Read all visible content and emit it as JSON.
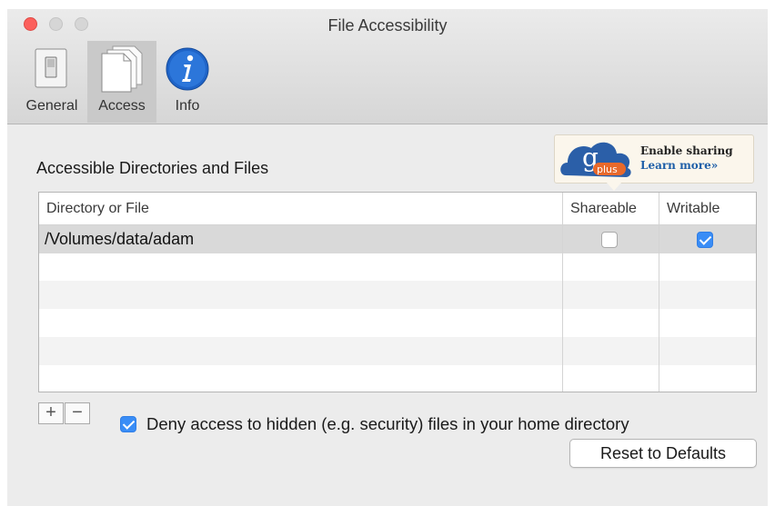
{
  "window": {
    "title": "File Accessibility"
  },
  "tabs": [
    {
      "label": "General",
      "icon": "switch-icon"
    },
    {
      "label": "Access",
      "icon": "documents-icon",
      "selected": true
    },
    {
      "label": "Info",
      "icon": "info-icon"
    }
  ],
  "section_title": "Accessible Directories and Files",
  "promo": {
    "line1": "Enable sharing",
    "line2": "Learn more»",
    "logo_letter": "g",
    "logo_word": "plus"
  },
  "table": {
    "columns": [
      "Directory or File",
      "Shareable",
      "Writable"
    ],
    "rows": [
      {
        "path": "/Volumes/data/adam",
        "shareable": false,
        "writable": true
      }
    ]
  },
  "controls": {
    "add_label": "+",
    "remove_label": "−",
    "deny_hidden": {
      "checked": true,
      "label": "Deny access to hidden (e.g. security) files in your home directory"
    },
    "reset_label": "Reset to Defaults"
  },
  "colors": {
    "accent": "#3a8df6",
    "close": "#fc605c",
    "info_blue": "#1f64c8"
  }
}
